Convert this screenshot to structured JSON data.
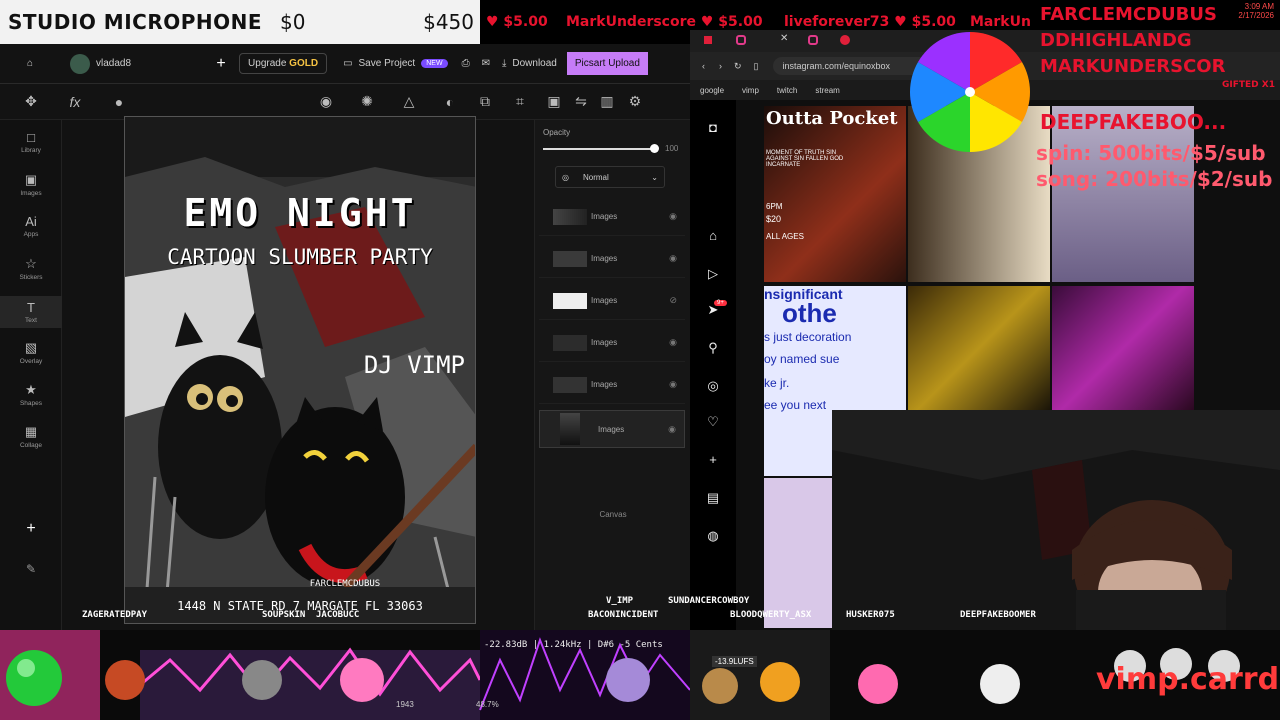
{
  "stream": {
    "mic_title": "STUDIO MICROPHONE",
    "mic_amount_left": "$0",
    "mic_amount_right": "$450",
    "tickers": [
      {
        "text": "♥ $5.00"
      },
      {
        "text": "MarkUnderscore ♥ $5.00"
      },
      {
        "text": "liveforever73 ♥ $5.00"
      },
      {
        "text": "MarkUn"
      }
    ],
    "clock": "3:09 AM",
    "date": "2/17/2026",
    "right_alerts": [
      "FARCLEMCDUBUS",
      "DDHIGHLANDG",
      "MARKUNDERSCOR",
      "DEEPFAKEBOO..."
    ],
    "gifted": "GIFTED X1",
    "spin_line1": "spin: 500bits/$5/sub",
    "spin_line2": "song: 200bits/$2/sub",
    "site": "vimp.carrd.co",
    "wheel_colors": [
      "#ff2a2a",
      "#ff9a00",
      "#ffe600",
      "#2bd52b",
      "#1e88ff",
      "#9b30ff"
    ]
  },
  "editor": {
    "username": "vladad8",
    "upgrade_label": "Upgrade",
    "upgrade_gold": "GOLD",
    "save_label": "Save Project",
    "new_badge": "NEW",
    "download_label": "Download",
    "upload_label": "Picsart Upload",
    "nav": [
      {
        "icon": "□",
        "label": "Library"
      },
      {
        "icon": "▣",
        "label": "Images"
      },
      {
        "icon": "Ai",
        "label": "Apps"
      },
      {
        "icon": "☆",
        "label": "Stickers"
      },
      {
        "icon": "T",
        "label": "Text"
      },
      {
        "icon": "▧",
        "label": "Overlay"
      },
      {
        "icon": "★",
        "label": "Shapes"
      },
      {
        "icon": "▦",
        "label": "Collage"
      }
    ],
    "opacity_label": "Opacity",
    "opacity_value": "100",
    "opacity_fraction": 1.0,
    "blend_mode": "Normal",
    "layers": [
      {
        "name": "Images"
      },
      {
        "name": "Images"
      },
      {
        "name": "Images"
      },
      {
        "name": "Images"
      },
      {
        "name": "Images"
      },
      {
        "name": "Images"
      }
    ],
    "canvas_label": "Canvas"
  },
  "poster": {
    "title": "EMO NIGHT",
    "subtitle": "CARTOON SLUMBER PARTY",
    "dj": "DJ VIMP",
    "address": "1448 N STATE RD 7 MARGATE FL 33063",
    "credit": "FARCLEMCDUBUS"
  },
  "browser": {
    "url": "instagram.com/equinoxbox",
    "bookmarks": [
      "google",
      "vimp",
      "twitch",
      "stream"
    ],
    "notif": "9+",
    "post1_title": "Outta Pocket",
    "post1_sub": "MOMENT OF TRUTH SIN AGAINST SIN FALLEN GOD INCARNATE",
    "post1_time": "6PM",
    "post1_price": "$20",
    "post1_ages": "ALL AGES",
    "post2_lines": [
      "nsignificant",
      "othe",
      "s just decoration",
      "oy named sue",
      "ke jr.",
      "ee you next"
    ]
  },
  "chat_names": [
    {
      "name": "V_IMP"
    },
    {
      "name": "SUNDANCERCOWBOY"
    },
    {
      "name": "ZAGERATEDPAY"
    },
    {
      "name": "SOUPSKIN"
    },
    {
      "name": "JACOBUCC"
    },
    {
      "name": "BACONINCIDENT"
    },
    {
      "name": "BLOODQWERTY_ASX"
    },
    {
      "name": "HUSKER075"
    },
    {
      "name": "DEEPFAKEBOOMER"
    }
  ],
  "audio": {
    "meter": "-22.83dB | 1.24kHz | D#6 -5 Cents",
    "lufs": "-13.9LUFS",
    "pct": "48.7%",
    "hz": "1943"
  }
}
